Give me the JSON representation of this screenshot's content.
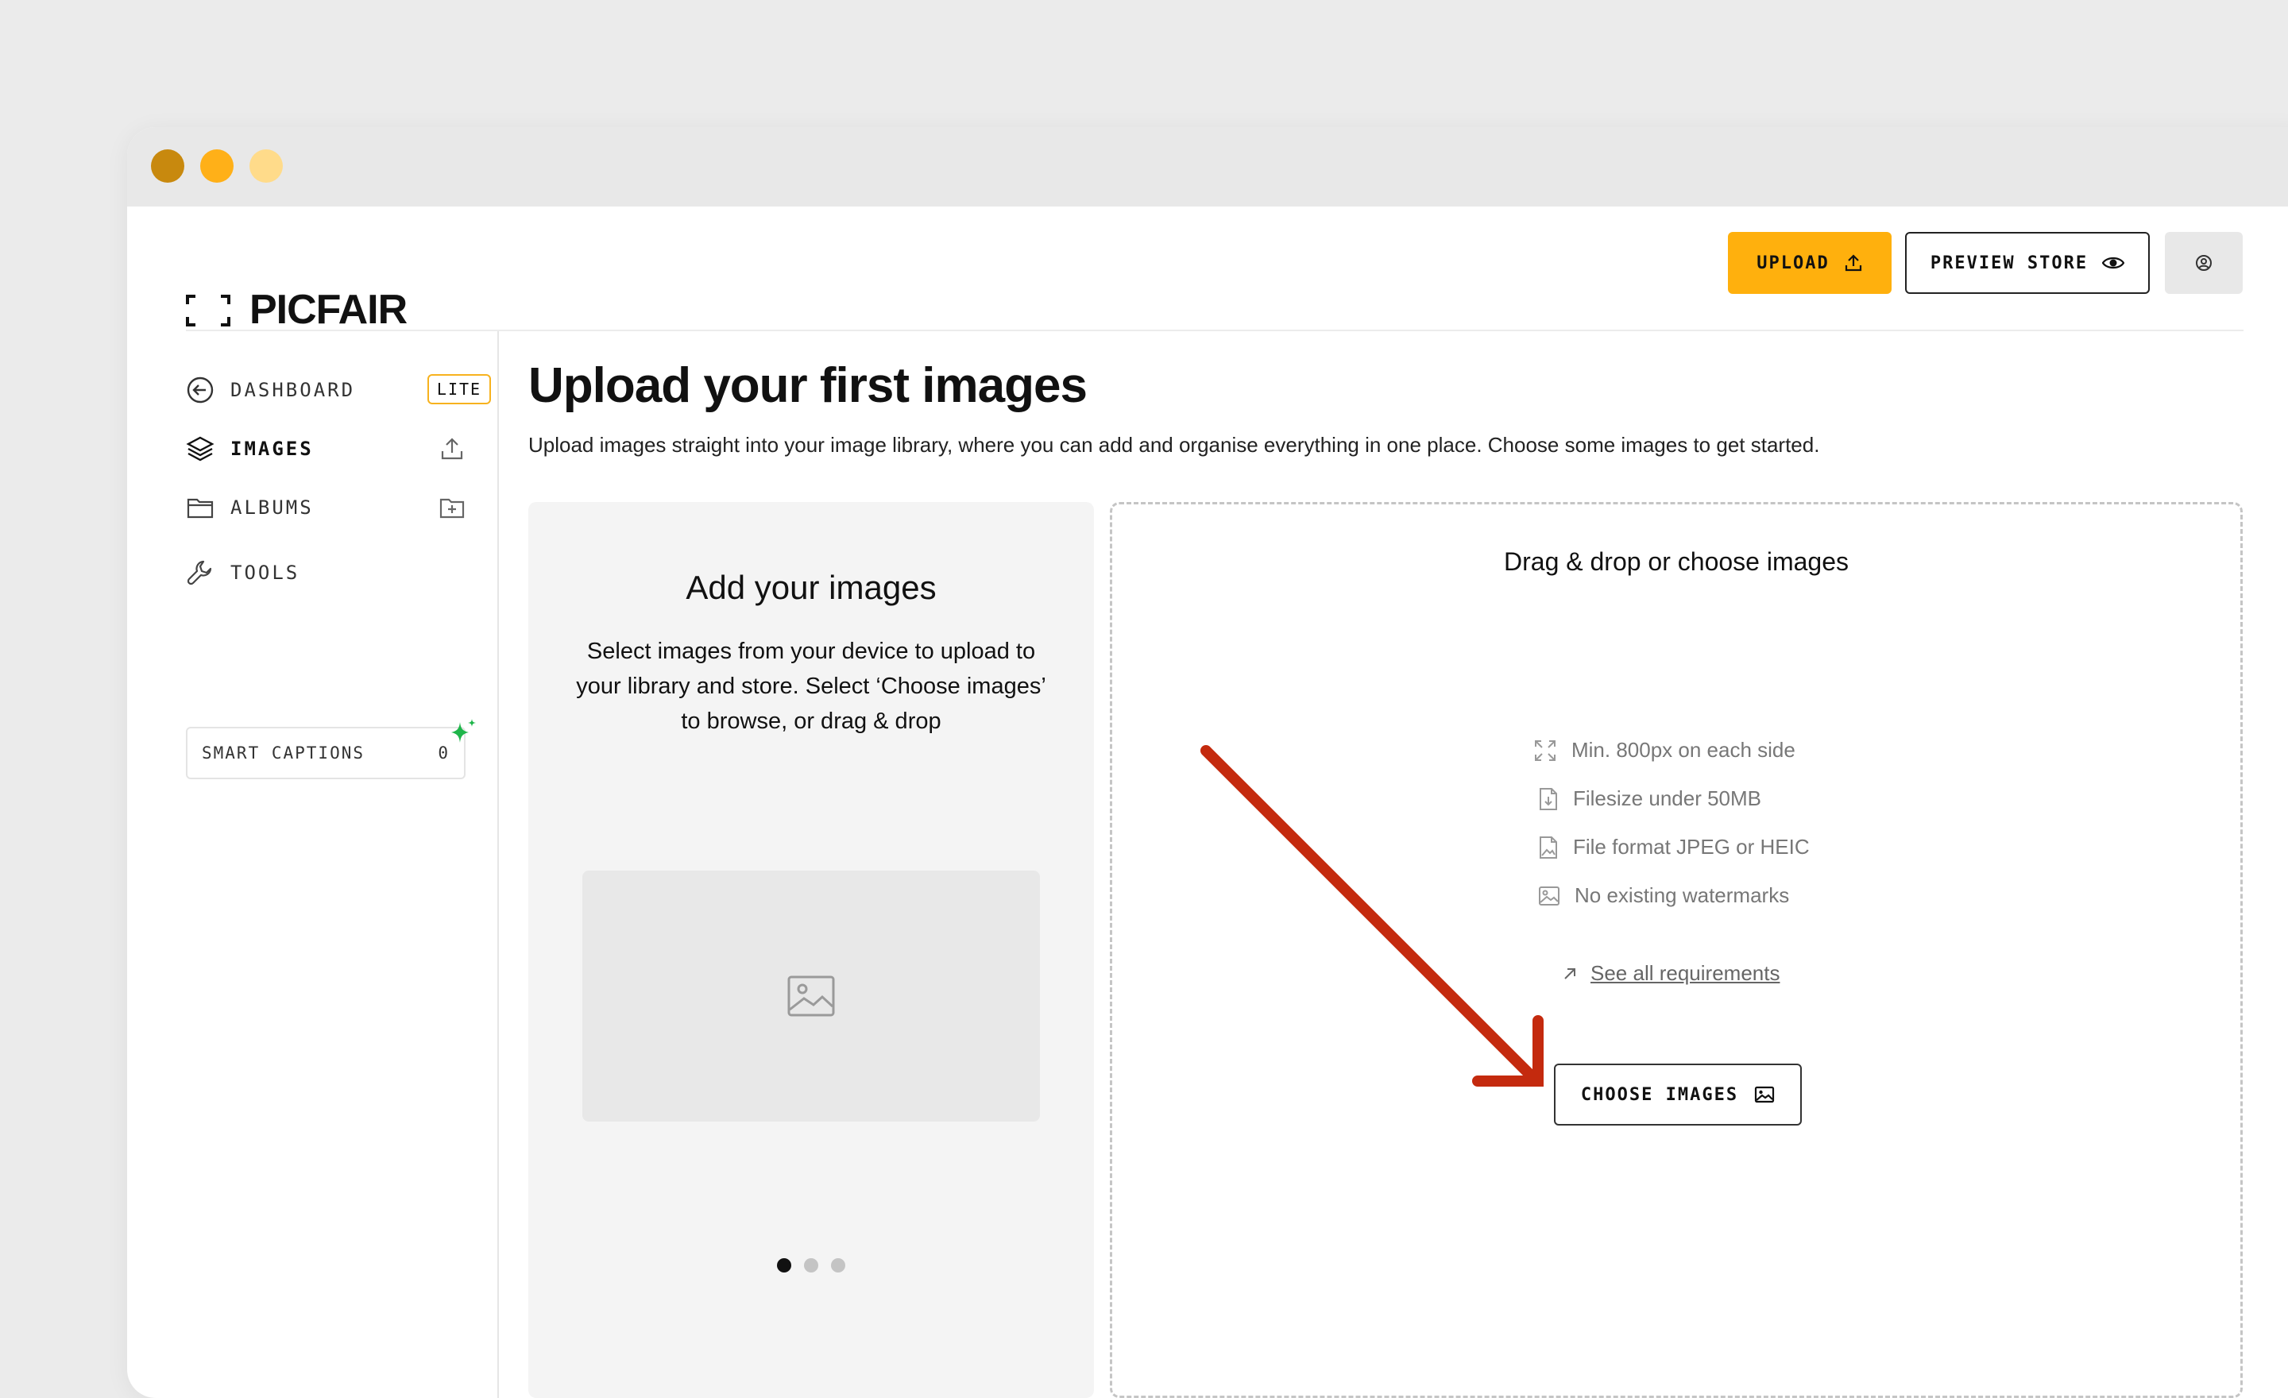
{
  "brand": {
    "name": "PICFAIR",
    "tier_badge": "LITE",
    "accent": "#ffb00d"
  },
  "header": {
    "upload_label": "UPLOAD",
    "preview_label": "PREVIEW STORE"
  },
  "sidebar": {
    "items": [
      {
        "label": "DASHBOARD",
        "icon": "arrow-left-circle-icon"
      },
      {
        "label": "IMAGES",
        "icon": "layers-icon",
        "action_icon": "upload-icon"
      },
      {
        "label": "ALBUMS",
        "icon": "folder-icon",
        "action_icon": "folder-plus-icon"
      },
      {
        "label": "TOOLS",
        "icon": "wrench-icon"
      }
    ],
    "smart_captions": {
      "label": "SMART CAPTIONS",
      "count": "0"
    }
  },
  "main": {
    "title": "Upload your first images",
    "subtitle": "Upload images straight into your image library, where you can add and organise everything in one place. Choose some images to get started."
  },
  "info_card": {
    "title": "Add your images",
    "text": "Select images from your device to upload to your library and store. Select ‘Choose images’ to browse, or drag & drop",
    "pager_total": 3,
    "pager_active": 1
  },
  "dropzone": {
    "title": "Drag & drop or choose images",
    "requirements": [
      {
        "text": "Min. 800px on each side",
        "icon": "expand-icon"
      },
      {
        "text": "Filesize under 50MB",
        "icon": "file-download-icon"
      },
      {
        "text": "File format JPEG or HEIC",
        "icon": "file-image-icon"
      },
      {
        "text": "No existing watermarks",
        "icon": "image-icon"
      }
    ],
    "requirements_link": "See all requirements",
    "choose_label": "CHOOSE IMAGES"
  },
  "annotation": {
    "color": "#c42a0e"
  }
}
